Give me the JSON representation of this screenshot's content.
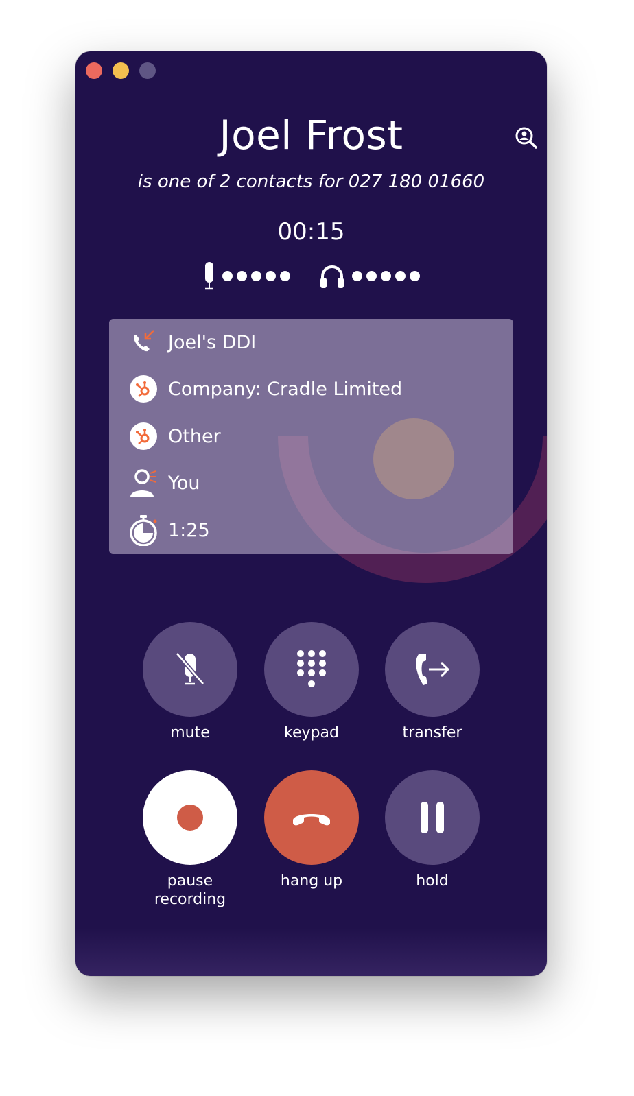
{
  "window": {
    "controls": [
      "close",
      "minimize",
      "maximize"
    ]
  },
  "caller": {
    "name": "Joel Frost",
    "subtitle": "is one of 2 contacts for 027 180 01660",
    "timer": "00:15"
  },
  "audio": {
    "mic_icon": "microphone-icon",
    "speaker_icon": "headphones-icon"
  },
  "info": {
    "rows": [
      {
        "icon": "incoming-call-icon",
        "label": "Joel's DDI"
      },
      {
        "icon": "hubspot-icon",
        "label": "Company: Cradle Limited"
      },
      {
        "icon": "hubspot-icon",
        "label": "Other"
      },
      {
        "icon": "user-icon",
        "label": "You"
      },
      {
        "icon": "stopwatch-icon",
        "label": "1:25"
      }
    ]
  },
  "controls": {
    "mute": "mute",
    "keypad": "keypad",
    "transfer": "transfer",
    "pause_recording_1": "pause",
    "pause_recording_2": "recording",
    "hang_up": "hang up",
    "hold": "hold"
  },
  "colors": {
    "background": "#20114b",
    "button": "#594a7d",
    "accent": "#cf5c47",
    "hubspot": "#f26b3a"
  }
}
